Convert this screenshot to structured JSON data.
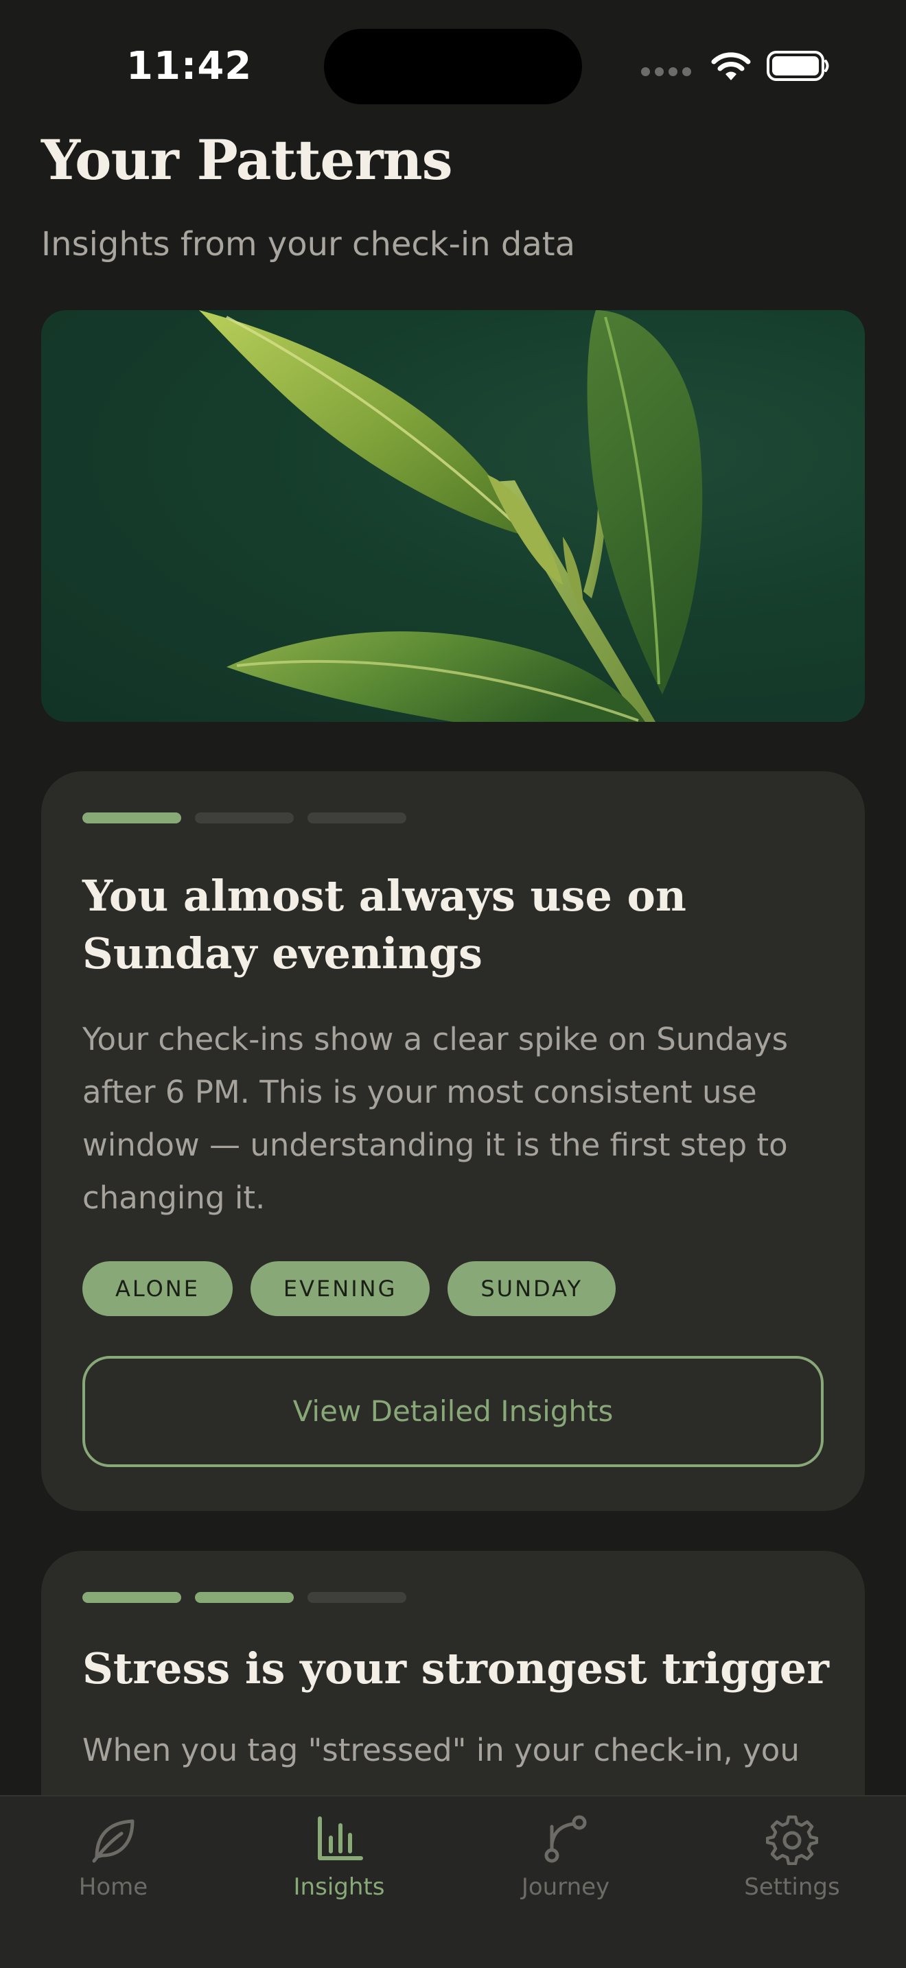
{
  "status_bar": {
    "time": "11:42"
  },
  "header": {
    "title": "Your Patterns",
    "subtitle": "Insights from your check-in data"
  },
  "hero": {
    "image": "tea-leaves-photo"
  },
  "cards": [
    {
      "progress": {
        "current": 1,
        "total": 3
      },
      "title": "You almost always use on Sunday evenings",
      "body": "Your check-ins show a clear spike on Sundays after 6 PM. This is your most consistent use window — understanding it is the first step to changing it.",
      "tags": [
        "ALONE",
        "EVENING",
        "SUNDAY"
      ],
      "button_label": "View Detailed Insights"
    },
    {
      "progress": {
        "current": 2,
        "total": 3
      },
      "title": "Stress is your strongest trigger",
      "body": "When you tag \"stressed\" in your check-in, you"
    }
  ],
  "tabbar": {
    "items": [
      {
        "label": "Home",
        "icon": "leaf-icon",
        "active": false
      },
      {
        "label": "Insights",
        "icon": "bar-chart-icon",
        "active": true
      },
      {
        "label": "Journey",
        "icon": "route-icon",
        "active": false
      },
      {
        "label": "Settings",
        "icon": "gear-icon",
        "active": false
      }
    ]
  },
  "colors": {
    "background": "#1b1b19",
    "card": "#2b2b27",
    "accent": "#88a878",
    "text_primary": "#f3efe6",
    "text_secondary": "#a6a39c",
    "tab_inactive": "#6c6b66"
  }
}
